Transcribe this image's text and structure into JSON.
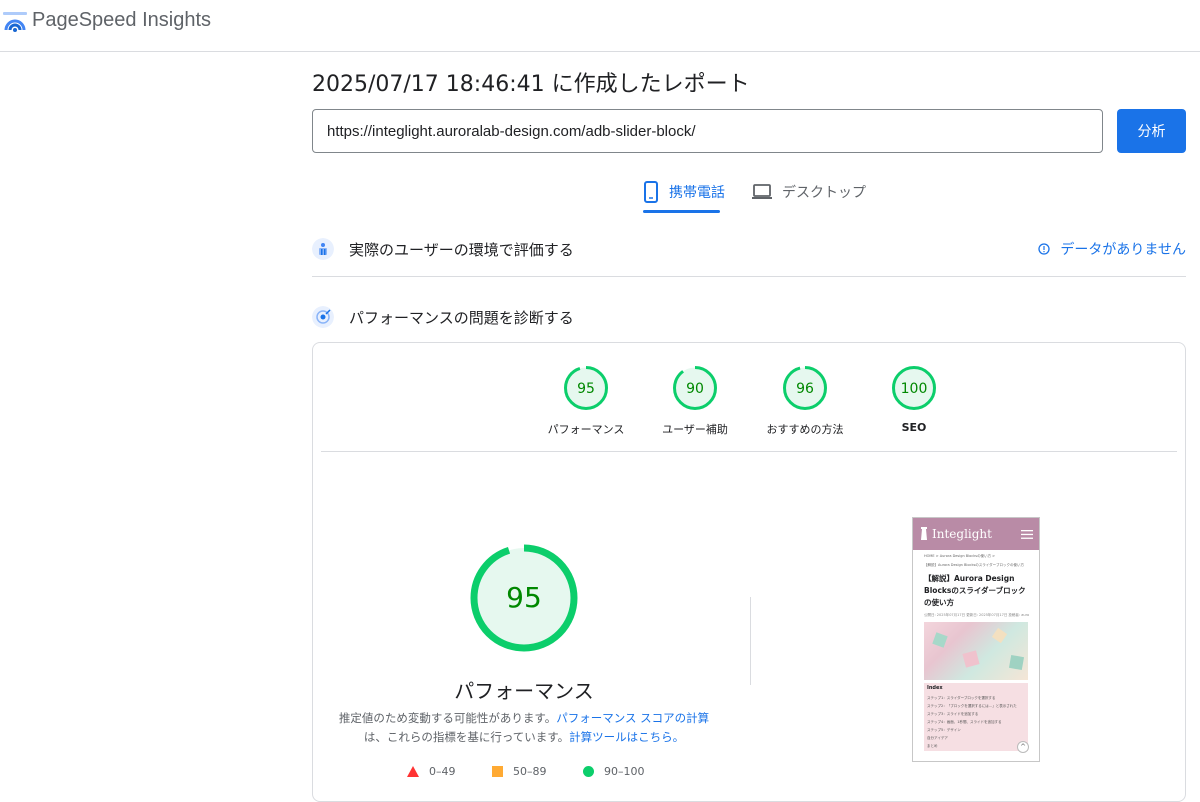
{
  "header": {
    "brand": "PageSpeed Insights"
  },
  "report": {
    "title": "2025/07/17 18:46:41 に作成したレポート"
  },
  "search": {
    "url": "https://integlight.auroralab-design.com/adb-slider-block/",
    "button_label": "分析"
  },
  "tabs": [
    {
      "label": "携帯電話",
      "icon": "phone-icon",
      "selected": true
    },
    {
      "label": "デスクトップ",
      "icon": "laptop-icon",
      "selected": false
    }
  ],
  "field_section": {
    "title": "実際のユーザーの環境で評価する",
    "status": "データがありません"
  },
  "lab_section": {
    "title": "パフォーマンスの問題を診断する"
  },
  "scores": [
    {
      "value": "95",
      "label": "パフォーマンス"
    },
    {
      "value": "90",
      "label": "ユーザー補助"
    },
    {
      "value": "96",
      "label": "おすすめの方法"
    },
    {
      "value": "100",
      "label": "SEO"
    }
  ],
  "performance": {
    "score": "95",
    "title": "パフォーマンス",
    "desc_text1": "推定値のため変動する可能性があります。",
    "desc_link1": "パフォーマンス スコアの計算",
    "desc_text2": "は、これらの指標を基に行っています。",
    "desc_link2": "計算ツールはこちら。"
  },
  "legend": [
    {
      "range": "0–49",
      "color": "#ff3333"
    },
    {
      "range": "50–89",
      "color": "#ffaa33"
    },
    {
      "range": "90–100",
      "color": "#0cce6b"
    }
  ],
  "screenshot": {
    "site_name": "Integlight",
    "breadcrumb": "HOME > Aurora Design Blocksの使い方 >",
    "sub": "【解説】Aurora Design Blocksのスライダーブロックの使い方",
    "article_title": "【解説】Aurora Design Blocksのスライダーブロックの使い方",
    "meta": "公開日: 2025年07月17日 更新日: 2025年07月17日 投稿者: auro",
    "toc_title": "Index",
    "toc": [
      "ステップ1：スライダーブロックを選択する",
      "ステップ2：「ブロックを選択するには…」と表示された",
      "ステップ3：スライドを追加する",
      "ステップ4：画面、1秒間、スライドを追加する",
      "ステップ5：デザイン",
      "自分アイデア",
      "まとめ"
    ]
  },
  "colors": {
    "accent": "#1a73e8",
    "good": "#0cce6b",
    "good_bg": "#e6f8ef",
    "good_text": "#008800"
  }
}
